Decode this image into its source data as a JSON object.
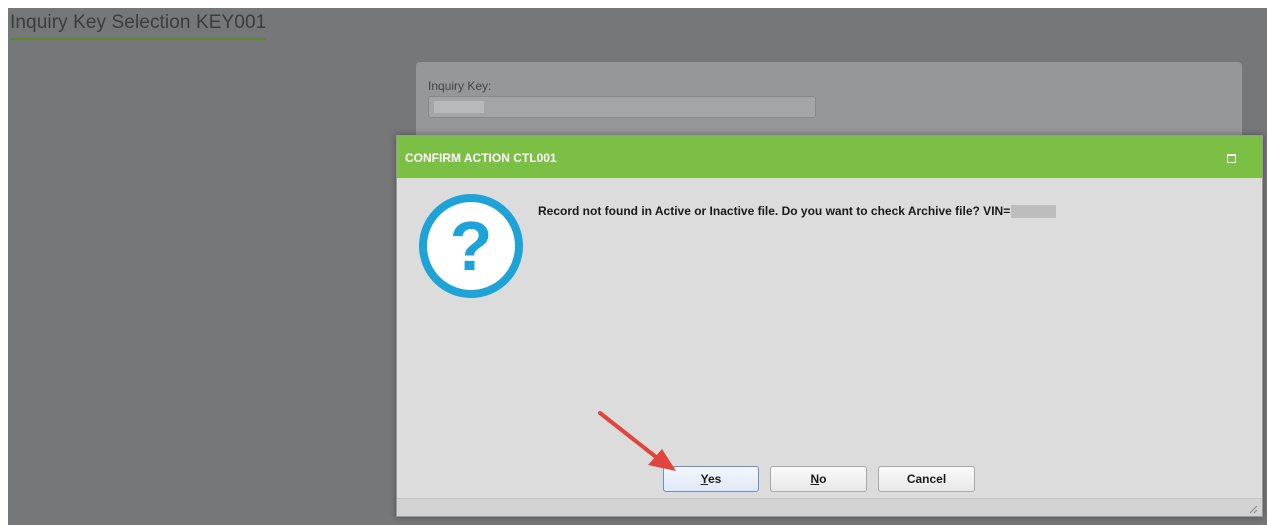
{
  "page": {
    "title": "Inquiry Key Selection KEY001",
    "inquiry_key_label": "Inquiry Key:",
    "inquiry_key_value": ""
  },
  "dialog": {
    "title": "CONFIRM ACTION CTL001",
    "icon": "question-icon",
    "message": "Record not found in Active or Inactive file. Do you want to check Archive file? VIN=",
    "buttons": {
      "yes_mnemonic": "Y",
      "yes_rest": "es",
      "no_mnemonic": "N",
      "no_rest": "o",
      "cancel": "Cancel"
    }
  },
  "colors": {
    "header_green": "#7bbf44",
    "icon_blue": "#1ea3d8",
    "overlay_gray": "#757778"
  },
  "annotation": {
    "icon": "red-arrow-pointer"
  }
}
